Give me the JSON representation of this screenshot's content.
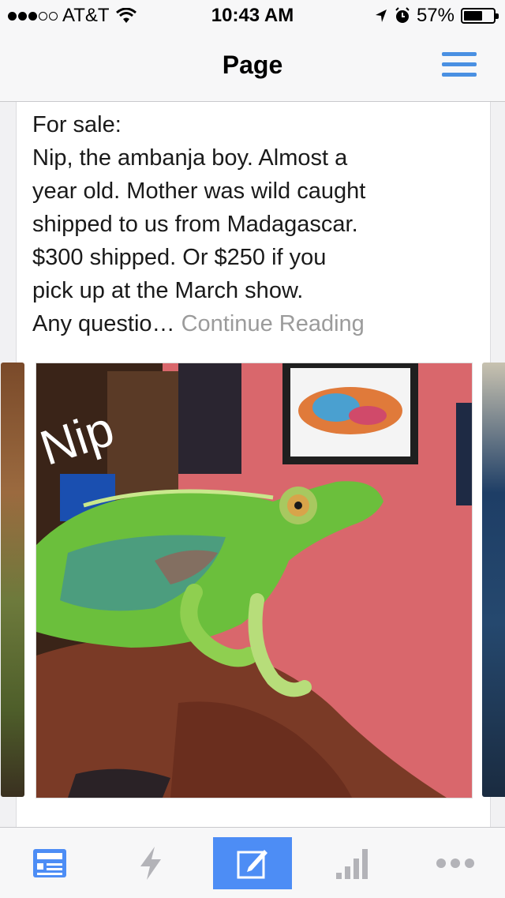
{
  "status_bar": {
    "carrier": "AT&T",
    "time": "10:43 AM",
    "battery": "57%",
    "battery_level": 0.57,
    "signal_bars": 3
  },
  "nav": {
    "title": "Page",
    "menu_icon": "hamburger-menu-icon",
    "accent_color": "#4a90e2"
  },
  "post": {
    "lines": [
      "For sale:",
      "Nip, the ambanja boy. Almost a",
      "year old. Mother was wild caught",
      "shipped to us from Madagascar.",
      "$300 shipped. Or $250 if you",
      "pick up at the March show."
    ],
    "last_line": "Any questio…",
    "continue_link": "Continue Reading",
    "photo_caption_overlay": "Nip"
  },
  "tab_bar": {
    "items": [
      {
        "icon": "page-icon",
        "active": false
      },
      {
        "icon": "lightning-icon",
        "active": false
      },
      {
        "icon": "compose-icon",
        "active": true
      },
      {
        "icon": "insights-icon",
        "active": false
      },
      {
        "icon": "more-icon",
        "active": false
      }
    ],
    "active_color": "#4d8df5"
  }
}
